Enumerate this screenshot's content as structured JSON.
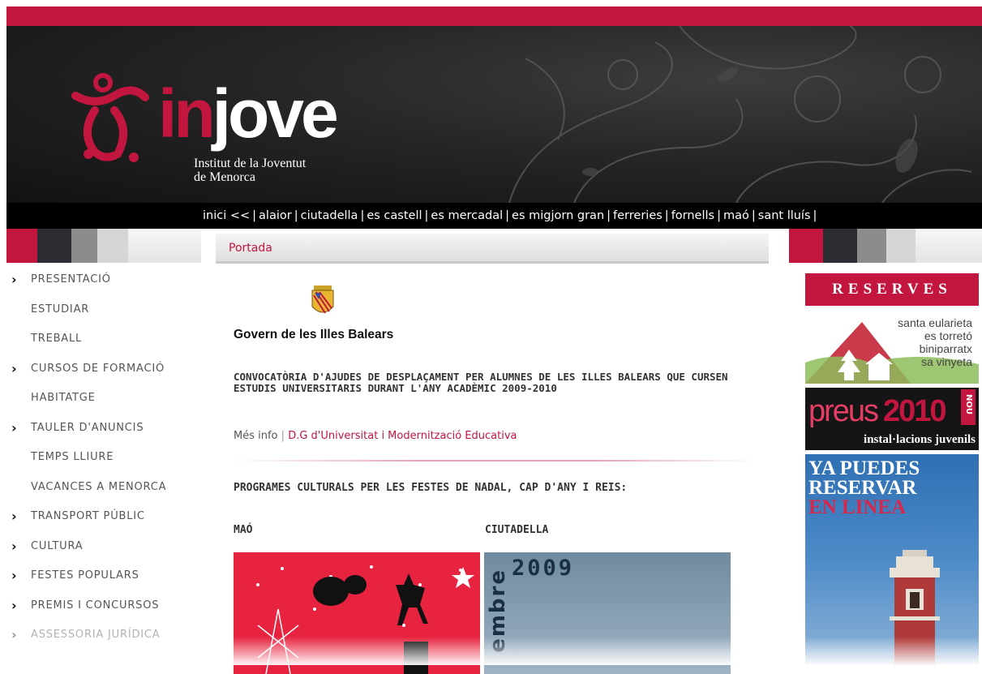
{
  "header": {
    "logo_in": "in",
    "logo_jove": "jove",
    "logo_sub_line1": "Institut de la Joventut",
    "logo_sub_line2": "de Menorca"
  },
  "nav": {
    "items": [
      "inici <<",
      "alaior",
      "ciutadella",
      "es castell",
      "es mercadal",
      "es migjorn gran",
      "ferreries",
      "fornells",
      "maó",
      "sant lluís"
    ]
  },
  "breadcrumb": "Portada",
  "sidebar": {
    "items": [
      {
        "label": "PRESENTACIÓ",
        "arrow": true
      },
      {
        "label": "ESTUDIAR",
        "arrow": false
      },
      {
        "label": "TREBALL",
        "arrow": false
      },
      {
        "label": "CURSOS DE FORMACIÓ",
        "arrow": true
      },
      {
        "label": "HABITATGE",
        "arrow": false
      },
      {
        "label": "TAULER D'ANUNCIS",
        "arrow": true
      },
      {
        "label": "TEMPS LLIURE",
        "arrow": false
      },
      {
        "label": "VACANCES A MENORCA",
        "arrow": false
      },
      {
        "label": "TRANSPORT PÚBLIC",
        "arrow": true
      },
      {
        "label": "CULTURA",
        "arrow": true
      },
      {
        "label": "FESTES POPULARS",
        "arrow": true
      },
      {
        "label": "PREMIS I CONCURSOS",
        "arrow": true
      },
      {
        "label": "ASSESSORIA JURÍDICA",
        "arrow": true
      }
    ]
  },
  "main": {
    "govern": "Govern de les Illes Balears",
    "convocatoria": "CONVOCATÒRIA D'AJUDES DE DESPLAÇAMENT PER ALUMNES DE LES ILLES BALEARS QUE CURSEN ESTUDIS UNIVERSITARIS DURANT L'ANY ACADÈMIC 2009-2010",
    "mes_info": "Més info",
    "info_sep": "|",
    "dg_link": "D.G d'Universitat i Modernització Educativa",
    "programes": "PROGRAMES CULTURALS PER LES FESTES DE NADAL, CAP D'ANY I REIS:",
    "col_mao": "MAÓ",
    "col_ciutadella": "CIUTADELLA",
    "ciutadella_year": "2009",
    "ciutadella_vertical": "embre"
  },
  "right": {
    "reserves_title": "RESERVES",
    "reserves_list": [
      "santa eularieta",
      "es torretó",
      "biniparratx",
      "sa vinyeta"
    ],
    "preus": "preus",
    "preus_year": "2010",
    "preus_nou": "NOU",
    "preus_sub": "instal·lacions juvenils",
    "ya_line1": "YA PUEDES",
    "ya_line2": "RESERVAR",
    "ya_line3": "EN LINEA"
  },
  "colors": {
    "brand_red": "#c2163f",
    "header_dark": "#1a1a1a"
  }
}
